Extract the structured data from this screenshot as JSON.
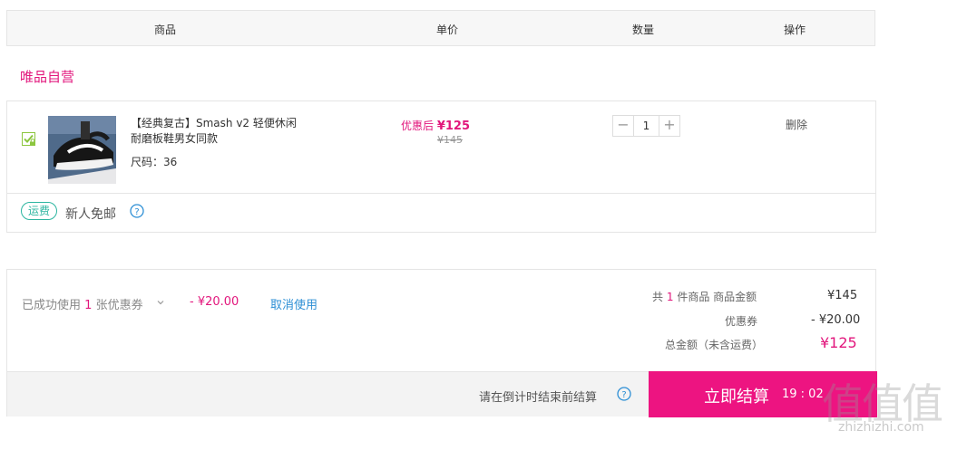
{
  "header": {
    "col_product": "商品",
    "col_price": "单价",
    "col_qty": "数量",
    "col_action": "操作"
  },
  "store": {
    "name": "唯品自营"
  },
  "item": {
    "title": "【经典复古】Smash v2 轻便休闲耐磨板鞋男女同款",
    "size": "尺码：36",
    "price_label": "优惠后",
    "price_now": "¥125",
    "price_old": "¥145",
    "quantity": "1",
    "qty_minus": "−",
    "qty_plus": "+",
    "delete": "删除"
  },
  "shipping": {
    "tag": "运费",
    "text": "新人免邮"
  },
  "coupon": {
    "prefix": "已成功使用",
    "count": "1",
    "suffix": "张优惠券",
    "amount": "- ¥20.00",
    "cancel": "取消使用"
  },
  "summary": {
    "total_prefix": "共",
    "total_count": "1",
    "total_suffix": "件商品  商品金额",
    "goods_amount": "¥145",
    "coupon_label": "优惠券",
    "coupon_amount": "- ¥20.00",
    "grand_label": "总金额（未含运费）",
    "grand_amount": "¥125"
  },
  "footer": {
    "hint": "请在倒计时结束前结算",
    "checkout": "立即结算",
    "timer": "19 : 02"
  },
  "watermark": {
    "glyphs": "值值值",
    "url": "zhizhizhi.com"
  },
  "colors": {
    "accent": "#e2167c",
    "checkout_bg": "#ed1481",
    "link": "#2d8fd5",
    "ship_tag": "#2cb5a0",
    "checkbox": "#8cc63f"
  }
}
